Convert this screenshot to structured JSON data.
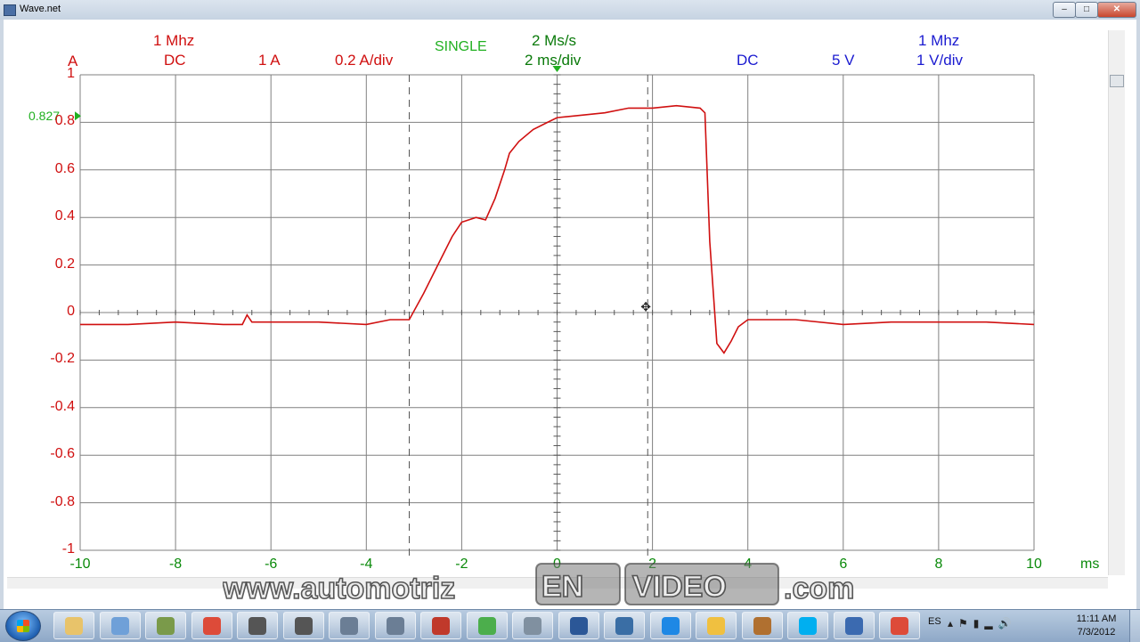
{
  "window": {
    "title": "Wave.net",
    "minimize": "–",
    "maximize": "□",
    "close": "✕"
  },
  "header": {
    "ch_a": {
      "label": "A",
      "bandwidth": "1 Mhz",
      "coupling": "DC",
      "range": "1 A",
      "scale": "0.2 A/div"
    },
    "trigger_mode": "SINGLE",
    "timebase": {
      "sample_rate": "2 Ms/s",
      "scale": "2 ms/div"
    },
    "ch_b": {
      "coupling": "DC",
      "range": "5 V",
      "bandwidth": "1 Mhz",
      "scale": "1 V/div"
    },
    "trigger_level": "0.827"
  },
  "colors": {
    "trace": "#d01010",
    "grid": "#808080",
    "ch_a": "#d01010",
    "time": "#0a8a0a",
    "ch_b": "#1a1ad0",
    "trigger": "#20b020"
  },
  "chart_data": {
    "type": "line",
    "title": "",
    "xlabel": "ms",
    "ylabel": "A",
    "xlim": [
      -10,
      10
    ],
    "ylim": [
      -1,
      1
    ],
    "x_ticks": [
      "-10",
      "-8",
      "-6",
      "-4",
      "-2",
      "0",
      "2",
      "4",
      "6",
      "8",
      "10"
    ],
    "y_ticks": [
      "1",
      "0.8",
      "0.6",
      "0.4",
      "0.2",
      "0",
      "-0.2",
      "-0.4",
      "-0.6",
      "-0.8",
      "-1"
    ],
    "grid": true,
    "cursors_x": [
      -3.1,
      1.9
    ],
    "series": [
      {
        "color": "#d01010",
        "x": [
          -10,
          -9,
          -8,
          -7,
          -6.6,
          -6.5,
          -6.4,
          -6,
          -5,
          -4,
          -3.5,
          -3.1,
          -2.8,
          -2.5,
          -2.2,
          -2,
          -1.7,
          -1.5,
          -1.3,
          -1.1,
          -1,
          -0.8,
          -0.5,
          -0.2,
          0,
          0.5,
          1,
          1.5,
          2,
          2.5,
          3,
          3.1,
          3.2,
          3.35,
          3.5,
          3.65,
          3.8,
          4,
          4.5,
          5,
          6,
          7,
          8,
          9,
          10
        ],
        "y": [
          -0.05,
          -0.05,
          -0.04,
          -0.05,
          -0.05,
          -0.01,
          -0.04,
          -0.04,
          -0.04,
          -0.05,
          -0.03,
          -0.03,
          0.08,
          0.2,
          0.32,
          0.38,
          0.4,
          0.39,
          0.48,
          0.6,
          0.67,
          0.72,
          0.77,
          0.8,
          0.82,
          0.83,
          0.84,
          0.86,
          0.86,
          0.87,
          0.86,
          0.84,
          0.3,
          -0.13,
          -0.17,
          -0.12,
          -0.06,
          -0.03,
          -0.03,
          -0.03,
          -0.05,
          -0.04,
          -0.04,
          -0.04,
          -0.05
        ]
      }
    ]
  },
  "watermark": "www.automotrizENVIDEO.com",
  "taskbar": {
    "apps": [
      "explorer",
      "wave-app",
      "tool",
      "chrome",
      "app5",
      "app6",
      "app7",
      "app8",
      "filezilla",
      "talk",
      "calculator",
      "word",
      "app13",
      "teamviewer",
      "mail",
      "settings",
      "skype",
      "network-app",
      "chrome-2"
    ],
    "lang": "ES",
    "time": "11:11 AM",
    "date": "7/3/2012"
  }
}
